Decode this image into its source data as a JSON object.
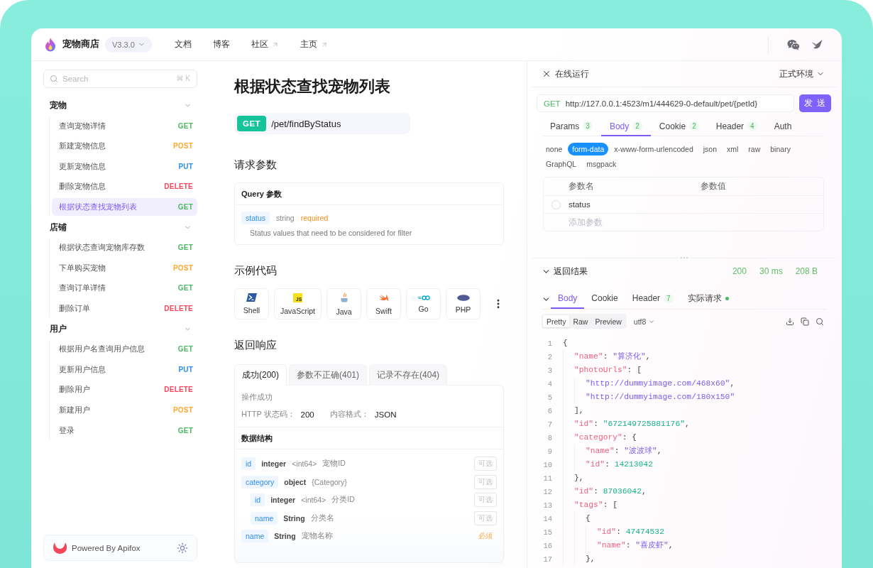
{
  "header": {
    "app_name": "宠物商店",
    "version": "V3.3.0",
    "nav": [
      {
        "label": "文档",
        "external": false
      },
      {
        "label": "博客",
        "external": false
      },
      {
        "label": "社区",
        "external": true
      },
      {
        "label": "主页",
        "external": true
      }
    ]
  },
  "sidebar": {
    "search": {
      "placeholder": "Search",
      "shortcut": "⌘ K"
    },
    "groups": [
      {
        "title": "宠物",
        "expanded": true,
        "items": [
          {
            "label": "查询宠物详情",
            "method": "GET",
            "color": "#4cb862",
            "selected": false
          },
          {
            "label": "新建宠物信息",
            "method": "POST",
            "color": "#ffa92e",
            "selected": false
          },
          {
            "label": "更新宠物信息",
            "method": "PUT",
            "color": "#2b8ef3",
            "selected": false
          },
          {
            "label": "删除宠物信息",
            "method": "DELETE",
            "color": "#f5475b",
            "selected": false
          },
          {
            "label": "根据状态查找宠物列表",
            "method": "GET",
            "color": "#4cb862",
            "selected": true
          }
        ]
      },
      {
        "title": "店铺",
        "expanded": true,
        "items": [
          {
            "label": "根据状态查询宠物库存数",
            "method": "GET",
            "color": "#4cb862",
            "selected": false
          },
          {
            "label": "下单购买宠物",
            "method": "POST",
            "color": "#ffa92e",
            "selected": false
          },
          {
            "label": "查询订单详情",
            "method": "GET",
            "color": "#4cb862",
            "selected": false
          },
          {
            "label": "删除订单",
            "method": "DELETE",
            "color": "#f5475b",
            "selected": false
          }
        ]
      },
      {
        "title": "用户",
        "expanded": true,
        "items": [
          {
            "label": "根据用户名查询用户信息",
            "method": "GET",
            "color": "#4cb862",
            "selected": false
          },
          {
            "label": "更新用户信息",
            "method": "PUT",
            "color": "#2b8ef3",
            "selected": false
          },
          {
            "label": "删除用户",
            "method": "DELETE",
            "color": "#f5475b",
            "selected": false
          },
          {
            "label": "新建用户",
            "method": "POST",
            "color": "#ffa92e",
            "selected": false
          },
          {
            "label": "登录",
            "method": "GET",
            "color": "#4cb862",
            "selected": false
          }
        ]
      }
    ],
    "footer": {
      "text": "Powered By Apifox"
    }
  },
  "doc": {
    "title": "根据状态查找宠物列表",
    "method": "GET",
    "path": "/pet/findByStatus",
    "request_section": "请求参数",
    "query": {
      "title": "Query 参数",
      "params": [
        {
          "name": "status",
          "type": "string",
          "required": true,
          "required_label": "required",
          "description": "Status values that need to be considered for filter"
        }
      ]
    },
    "examples_section": "示例代码",
    "languages": [
      {
        "kind": "shell",
        "label": "Shell"
      },
      {
        "kind": "javascript",
        "label": "JavaScript",
        "logo_text": "JS"
      },
      {
        "kind": "java",
        "label": "Java"
      },
      {
        "kind": "swift",
        "label": "Swift"
      },
      {
        "kind": "go",
        "label": "Go"
      },
      {
        "kind": "php",
        "label": "PHP"
      }
    ],
    "response_section": "返回响应",
    "response_tabs": [
      {
        "label": "成功(200)",
        "selected": true
      },
      {
        "label": "参数不正确(401)",
        "selected": false
      },
      {
        "label": "记录不存在(404)",
        "selected": false
      }
    ],
    "response": {
      "description": "操作成功",
      "status_label": "HTTP 状态码：",
      "status_code": "200",
      "format_label": "内容格式：",
      "format": "JSON",
      "schema_title": "数据结构",
      "fields": [
        {
          "name": "id",
          "type": "integer",
          "format": "<int64>",
          "description": "宠物ID",
          "required": false,
          "tag": "可选"
        },
        {
          "name": "category",
          "type": "object",
          "format": "{Category}",
          "required": false,
          "tag": "可选",
          "children": [
            {
              "name": "id",
              "type": "integer",
              "format": "<int64>",
              "description": "分类ID",
              "required": false,
              "tag": "可选"
            },
            {
              "name": "name",
              "type": "String",
              "description": "分类名",
              "required": false,
              "tag": "可选"
            }
          ]
        },
        {
          "name": "name",
          "type": "String",
          "description": "宠物名称",
          "required": true,
          "tag": "必须"
        }
      ]
    }
  },
  "runner": {
    "title": "在线运行",
    "environment": "正式环境",
    "request": {
      "method": "GET",
      "url": "http://127.0.0.1:4523/m1/444629-0-default/pet/{petId}",
      "send_label": "发 送"
    },
    "tabs": [
      {
        "label": "Params",
        "count": "3",
        "selected": false
      },
      {
        "label": "Body",
        "count": "2",
        "selected": true
      },
      {
        "label": "Cookie",
        "count": "2",
        "selected": false
      },
      {
        "label": "Header",
        "count": "4",
        "selected": false
      },
      {
        "label": "Auth",
        "selected": false
      }
    ],
    "body_types": [
      {
        "label": "none",
        "selected": false
      },
      {
        "label": "form-data",
        "selected": true
      },
      {
        "label": "x-www-form-urlencoded",
        "selected": false
      },
      {
        "label": "json",
        "selected": false
      },
      {
        "label": "xml",
        "selected": false
      },
      {
        "label": "raw",
        "selected": false
      },
      {
        "label": "binary",
        "selected": false
      },
      {
        "label": "GraphQL",
        "selected": false
      },
      {
        "label": "msgpack",
        "selected": false
      }
    ],
    "params_table": {
      "columns": [
        "参数名",
        "参数值"
      ],
      "rows": [
        {
          "name": "status",
          "checked": false
        }
      ],
      "add_placeholder": "添加参数"
    },
    "result": {
      "title": "返回结果",
      "expanded": true,
      "status": "200",
      "time": "30 ms",
      "size": "208 B",
      "tabs": [
        {
          "label": "Body",
          "selected": true,
          "dot": false
        },
        {
          "label": "Cookie",
          "selected": false,
          "dot": false
        },
        {
          "label": "Header",
          "count": "7",
          "selected": false,
          "dot": false
        },
        {
          "label": "实际请求",
          "selected": false,
          "dot": true
        }
      ],
      "view_modes": [
        {
          "label": "Pretty",
          "selected": true
        },
        {
          "label": "Raw",
          "selected": false
        },
        {
          "label": "Preview",
          "selected": false
        }
      ],
      "encoding": "utf8",
      "code": [
        {
          "number": "1",
          "tokens": [
            {
              "kind": "punct",
              "text": "{"
            }
          ],
          "children": [
            {
              "number": "2",
              "tokens": [
                {
                  "kind": "key",
                  "text": "\"name\""
                },
                {
                  "kind": "punct",
                  "text": ": "
                },
                {
                  "kind": "string",
                  "text": "\"算济化\""
                },
                {
                  "kind": "punct",
                  "text": ","
                }
              ]
            },
            {
              "number": "3",
              "tokens": [
                {
                  "kind": "key",
                  "text": "\"photoUrls\""
                },
                {
                  "kind": "punct",
                  "text": ": ["
                }
              ],
              "children": [
                {
                  "number": "4",
                  "tokens": [
                    {
                      "kind": "string",
                      "text": "\"http://dummyimage.com/468x60\""
                    },
                    {
                      "kind": "punct",
                      "text": ","
                    }
                  ]
                },
                {
                  "number": "5",
                  "tokens": [
                    {
                      "kind": "string",
                      "text": "\"http://dummyimage.com/180x150\""
                    }
                  ]
                }
              ],
              "close": {
                "number": "6",
                "tokens": [
                  {
                    "kind": "punct",
                    "text": "],"
                  }
                ]
              }
            },
            {
              "number": "7",
              "tokens": [
                {
                  "kind": "key",
                  "text": "\"id\""
                },
                {
                  "kind": "punct",
                  "text": ": "
                },
                {
                  "kind": "number",
                  "text": "\"672149725881176\""
                },
                {
                  "kind": "punct",
                  "text": ","
                }
              ]
            },
            {
              "number": "8",
              "tokens": [
                {
                  "kind": "key",
                  "text": "\"category\""
                },
                {
                  "kind": "punct",
                  "text": ": {"
                }
              ],
              "children": [
                {
                  "number": "9",
                  "tokens": [
                    {
                      "kind": "key",
                      "text": "\"name\""
                    },
                    {
                      "kind": "punct",
                      "text": ": "
                    },
                    {
                      "kind": "string",
                      "text": "\"波波球\""
                    },
                    {
                      "kind": "punct",
                      "text": ","
                    }
                  ]
                },
                {
                  "number": "10",
                  "tokens": [
                    {
                      "kind": "key",
                      "text": "\"id\""
                    },
                    {
                      "kind": "punct",
                      "text": ": "
                    },
                    {
                      "kind": "number",
                      "text": "14213042"
                    }
                  ]
                }
              ],
              "close": {
                "number": "11",
                "tokens": [
                  {
                    "kind": "punct",
                    "text": "},"
                  }
                ]
              }
            },
            {
              "number": "12",
              "tokens": [
                {
                  "kind": "key",
                  "text": "\"id\""
                },
                {
                  "kind": "punct",
                  "text": ": "
                },
                {
                  "kind": "number",
                  "text": "87036042"
                },
                {
                  "kind": "punct",
                  "text": ","
                }
              ]
            },
            {
              "number": "13",
              "tokens": [
                {
                  "kind": "key",
                  "text": "\"tags\""
                },
                {
                  "kind": "punct",
                  "text": ": ["
                }
              ],
              "children": [
                {
                  "number": "14",
                  "tokens": [
                    {
                      "kind": "punct",
                      "text": "{"
                    }
                  ],
                  "children": [
                    {
                      "number": "15",
                      "tokens": [
                        {
                          "kind": "key",
                          "text": "\"id\""
                        },
                        {
                          "kind": "punct",
                          "text": ": "
                        },
                        {
                          "kind": "number",
                          "text": "47474532"
                        }
                      ]
                    },
                    {
                      "number": "16",
                      "tokens": [
                        {
                          "kind": "key",
                          "text": "\"name\""
                        },
                        {
                          "kind": "punct",
                          "text": ": "
                        },
                        {
                          "kind": "string",
                          "text": "\"喜皮虾\""
                        },
                        {
                          "kind": "punct",
                          "text": ","
                        }
                      ]
                    }
                  ],
                  "close": {
                    "number": "17",
                    "tokens": [
                      {
                        "kind": "punct",
                        "text": "},"
                      }
                    ]
                  }
                }
              ]
            }
          ]
        }
      ]
    }
  }
}
